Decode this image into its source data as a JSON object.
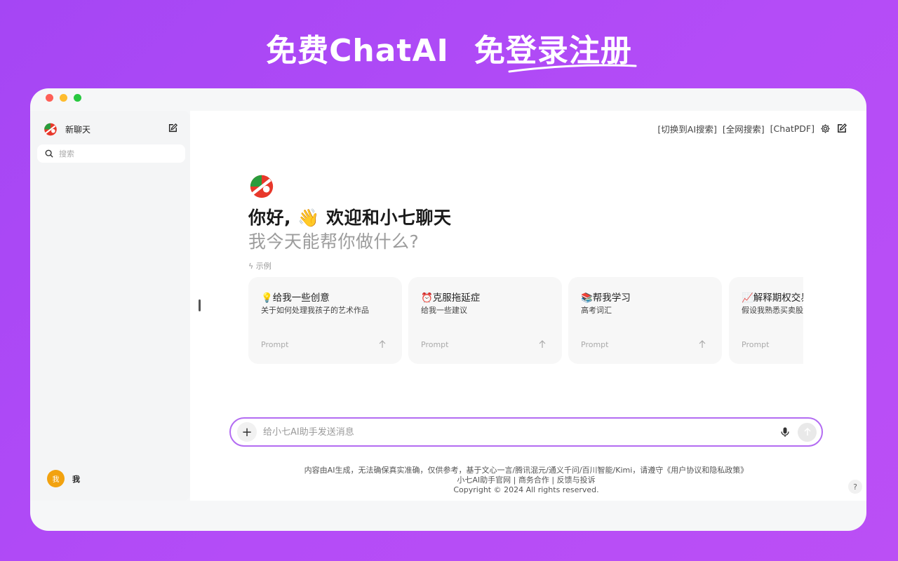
{
  "promo": {
    "title_part1": "免费ChatAI",
    "title_part2": "免登录注册"
  },
  "window": {
    "traffic_colors": [
      "#fe5f57",
      "#febc2e",
      "#28c840"
    ]
  },
  "sidebar": {
    "new_chat_label": "新聊天",
    "search_placeholder": "搜索",
    "user": {
      "avatar_text": "我",
      "name": "我",
      "avatar_color": "#f2a20f"
    }
  },
  "header": {
    "links": [
      "[切换到AI搜索]",
      "[全网搜索]",
      "[ChatPDF]"
    ],
    "icons": [
      "gear-icon",
      "edit-icon"
    ]
  },
  "hero": {
    "greeting": "你好, 👋 欢迎和小七聊天",
    "subtitle": "我今天能帮你做什么?"
  },
  "examples": {
    "label": "示例",
    "cards": [
      {
        "title": "💡给我一些创意",
        "desc": "关于如何处理我孩子的艺术作品",
        "prompt": "Prompt"
      },
      {
        "title": "⏰克服拖延症",
        "desc": "给我一些建议",
        "prompt": "Prompt"
      },
      {
        "title": "📚帮我学习",
        "desc": "高考词汇",
        "prompt": "Prompt"
      },
      {
        "title": "📈解释期权交易",
        "desc": "假设我熟悉买卖股票",
        "prompt": "Prompt"
      }
    ]
  },
  "composer": {
    "placeholder": "给小七AI助手发送消息",
    "accent": "#b36cf2"
  },
  "footer": {
    "line1": "内容由AI生成，无法确保真实准确，仅供参考，基于文心一言/腾讯混元/通义千问/百川智能/Kimi，请遵守《用户协议和隐私政策》",
    "links": [
      "小七AI助手官网",
      "商务合作",
      "反馈与投诉"
    ],
    "separator": " | ",
    "copyright": "Copyright © 2024 All rights reserved."
  },
  "help_label": "?"
}
